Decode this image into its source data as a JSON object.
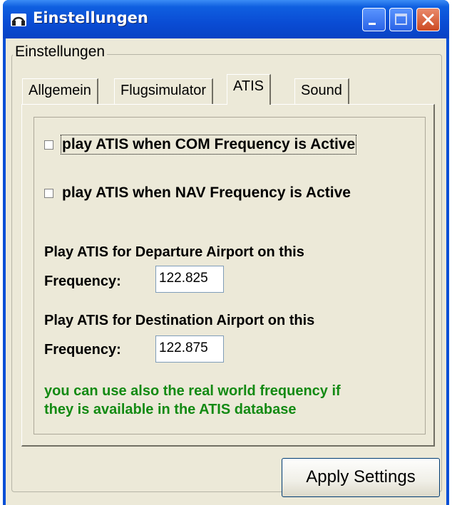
{
  "window": {
    "title": "Einstellungen",
    "icon": "headset-icon"
  },
  "group": {
    "label": "Einstellungen"
  },
  "tabs": [
    {
      "label": "Allgemein",
      "active": false
    },
    {
      "label": "Flugsimulator",
      "active": false
    },
    {
      "label": "ATIS",
      "active": true
    },
    {
      "label": "Sound",
      "active": false
    }
  ],
  "atis": {
    "com_checkbox_label": "play ATIS when COM Frequency is Active",
    "com_checked": false,
    "nav_checkbox_label": "play ATIS when NAV Frequency is Active",
    "nav_checked": false,
    "departure_label": "Play ATIS for Departure Airport on this",
    "departure_freq_label": "Frequency:",
    "departure_freq_value": "122.825",
    "destination_label": "Play ATIS for Destination Airport on this",
    "destination_freq_label": "Frequency:",
    "destination_freq_value": "122.875",
    "hint_line1": "you can use also the real world frequency if",
    "hint_line2": "they is available in the ATIS database"
  },
  "buttons": {
    "apply_label": "Apply Settings"
  },
  "colors": {
    "titlebar": "#0a4cd4",
    "face": "#ece9d8",
    "hint_text": "#138a13"
  }
}
